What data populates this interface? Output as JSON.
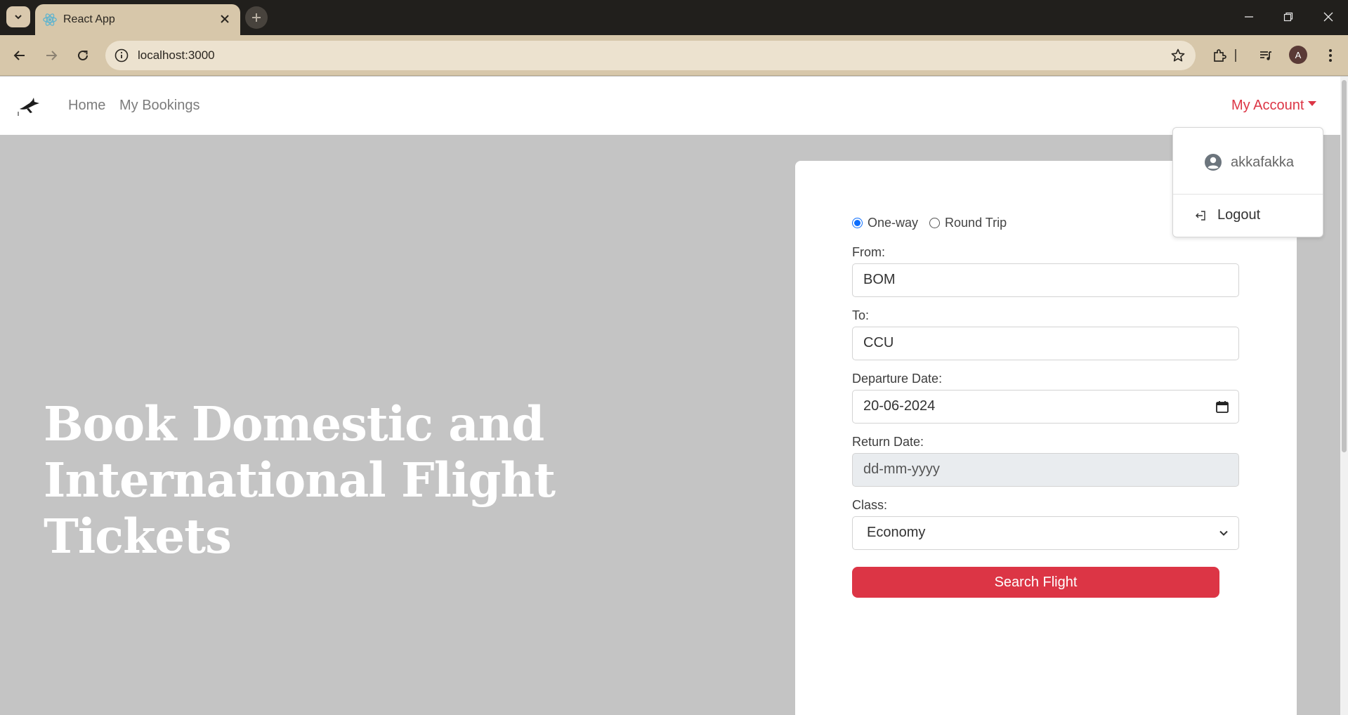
{
  "browser": {
    "tab_title": "React App",
    "url": "localhost:3000",
    "profile_initial": "A"
  },
  "navbar": {
    "home_label": "Home",
    "bookings_label": "My Bookings",
    "account_label": "My Account"
  },
  "dropdown": {
    "username": "akkafakka",
    "logout_label": "Logout"
  },
  "hero": {
    "line1": "Book Domestic and",
    "line2": "International Flight Tickets"
  },
  "form": {
    "trip_options": [
      "One-way",
      "Round Trip"
    ],
    "selected_trip": "One-way",
    "from_label": "From:",
    "from_value": "BOM",
    "to_label": "To:",
    "to_value": "CCU",
    "departure_label": "Departure Date:",
    "departure_value": "20-06-2024",
    "return_label": "Return Date:",
    "return_placeholder": "dd-mm-yyyy",
    "class_label": "Class:",
    "class_value": "Economy",
    "submit_label": "Search Flight"
  },
  "colors": {
    "accent_red": "#dc3545",
    "radio_blue": "#0d6efd",
    "hero_background": "#c4c4c4",
    "chrome_tan": "#d7c7aa"
  }
}
